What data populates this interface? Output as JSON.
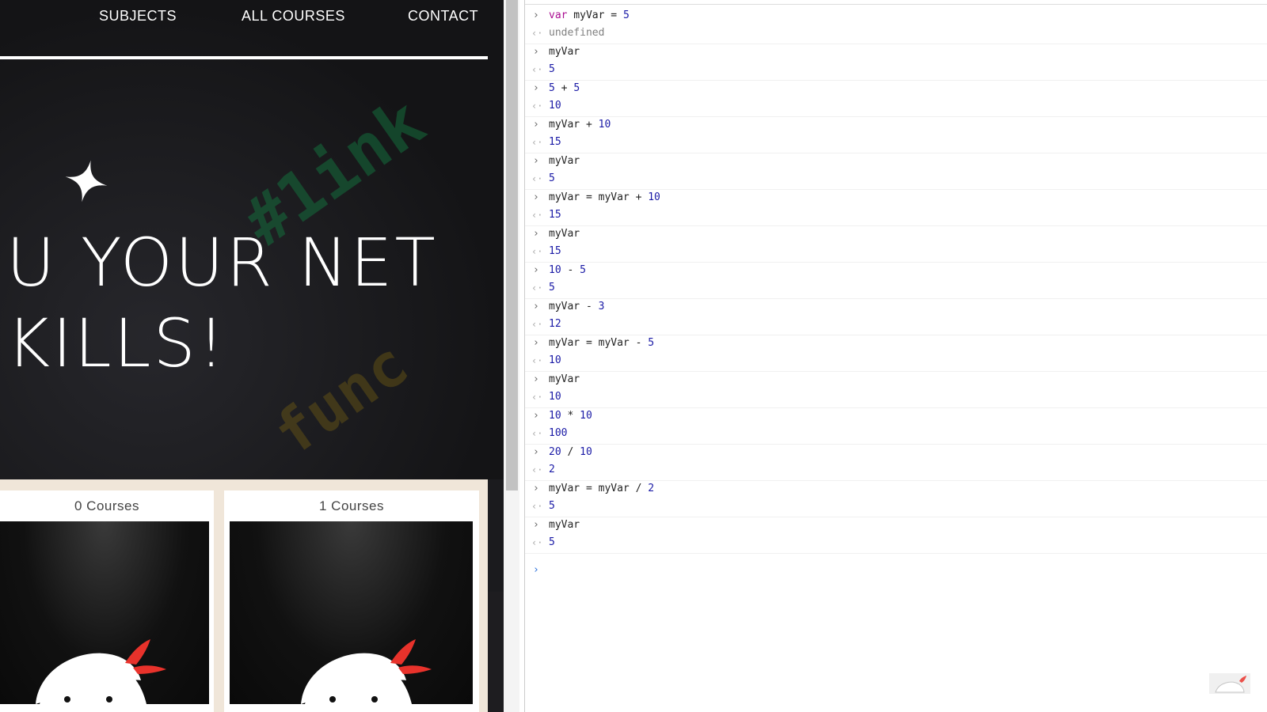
{
  "nav": {
    "subjects": "SUBJECTS",
    "all_courses": "ALL COURSES",
    "contact": "CONTACT"
  },
  "hero": {
    "line1": "U YOUR NET",
    "line2": "KILLS!"
  },
  "courses": [
    {
      "title": "0 Courses"
    },
    {
      "title": "1 Courses"
    }
  ],
  "console": {
    "entries": [
      {
        "input": "var myVar = 5",
        "output": "undefined"
      },
      {
        "input": "myVar",
        "output": "5"
      },
      {
        "input": "5 + 5",
        "output": "10"
      },
      {
        "input": "myVar + 10",
        "output": "15"
      },
      {
        "input": "myVar",
        "output": "5"
      },
      {
        "input": "myVar = myVar + 10",
        "output": "15"
      },
      {
        "input": "myVar",
        "output": "15"
      },
      {
        "input": "10 - 5",
        "output": "5"
      },
      {
        "input": "myVar - 3",
        "output": "12"
      },
      {
        "input": "myVar = myVar - 5",
        "output": "10"
      },
      {
        "input": "myVar",
        "output": "10"
      },
      {
        "input": "10 * 10",
        "output": "100"
      },
      {
        "input": "20 / 10",
        "output": "2"
      },
      {
        "input": "myVar = myVar / 2",
        "output": "5"
      },
      {
        "input": "myVar",
        "output": "5"
      }
    ]
  },
  "colors": {
    "number": "#1a1aa6",
    "keyword": "#aa0d91",
    "undefined": "#808080",
    "accent_red": "#e8322b"
  },
  "icons": {
    "hero_star": "star-icon",
    "card_mascot": "ninja-mascot-icon",
    "prompt": "chevron-right-icon",
    "result": "return-arrow-icon"
  }
}
